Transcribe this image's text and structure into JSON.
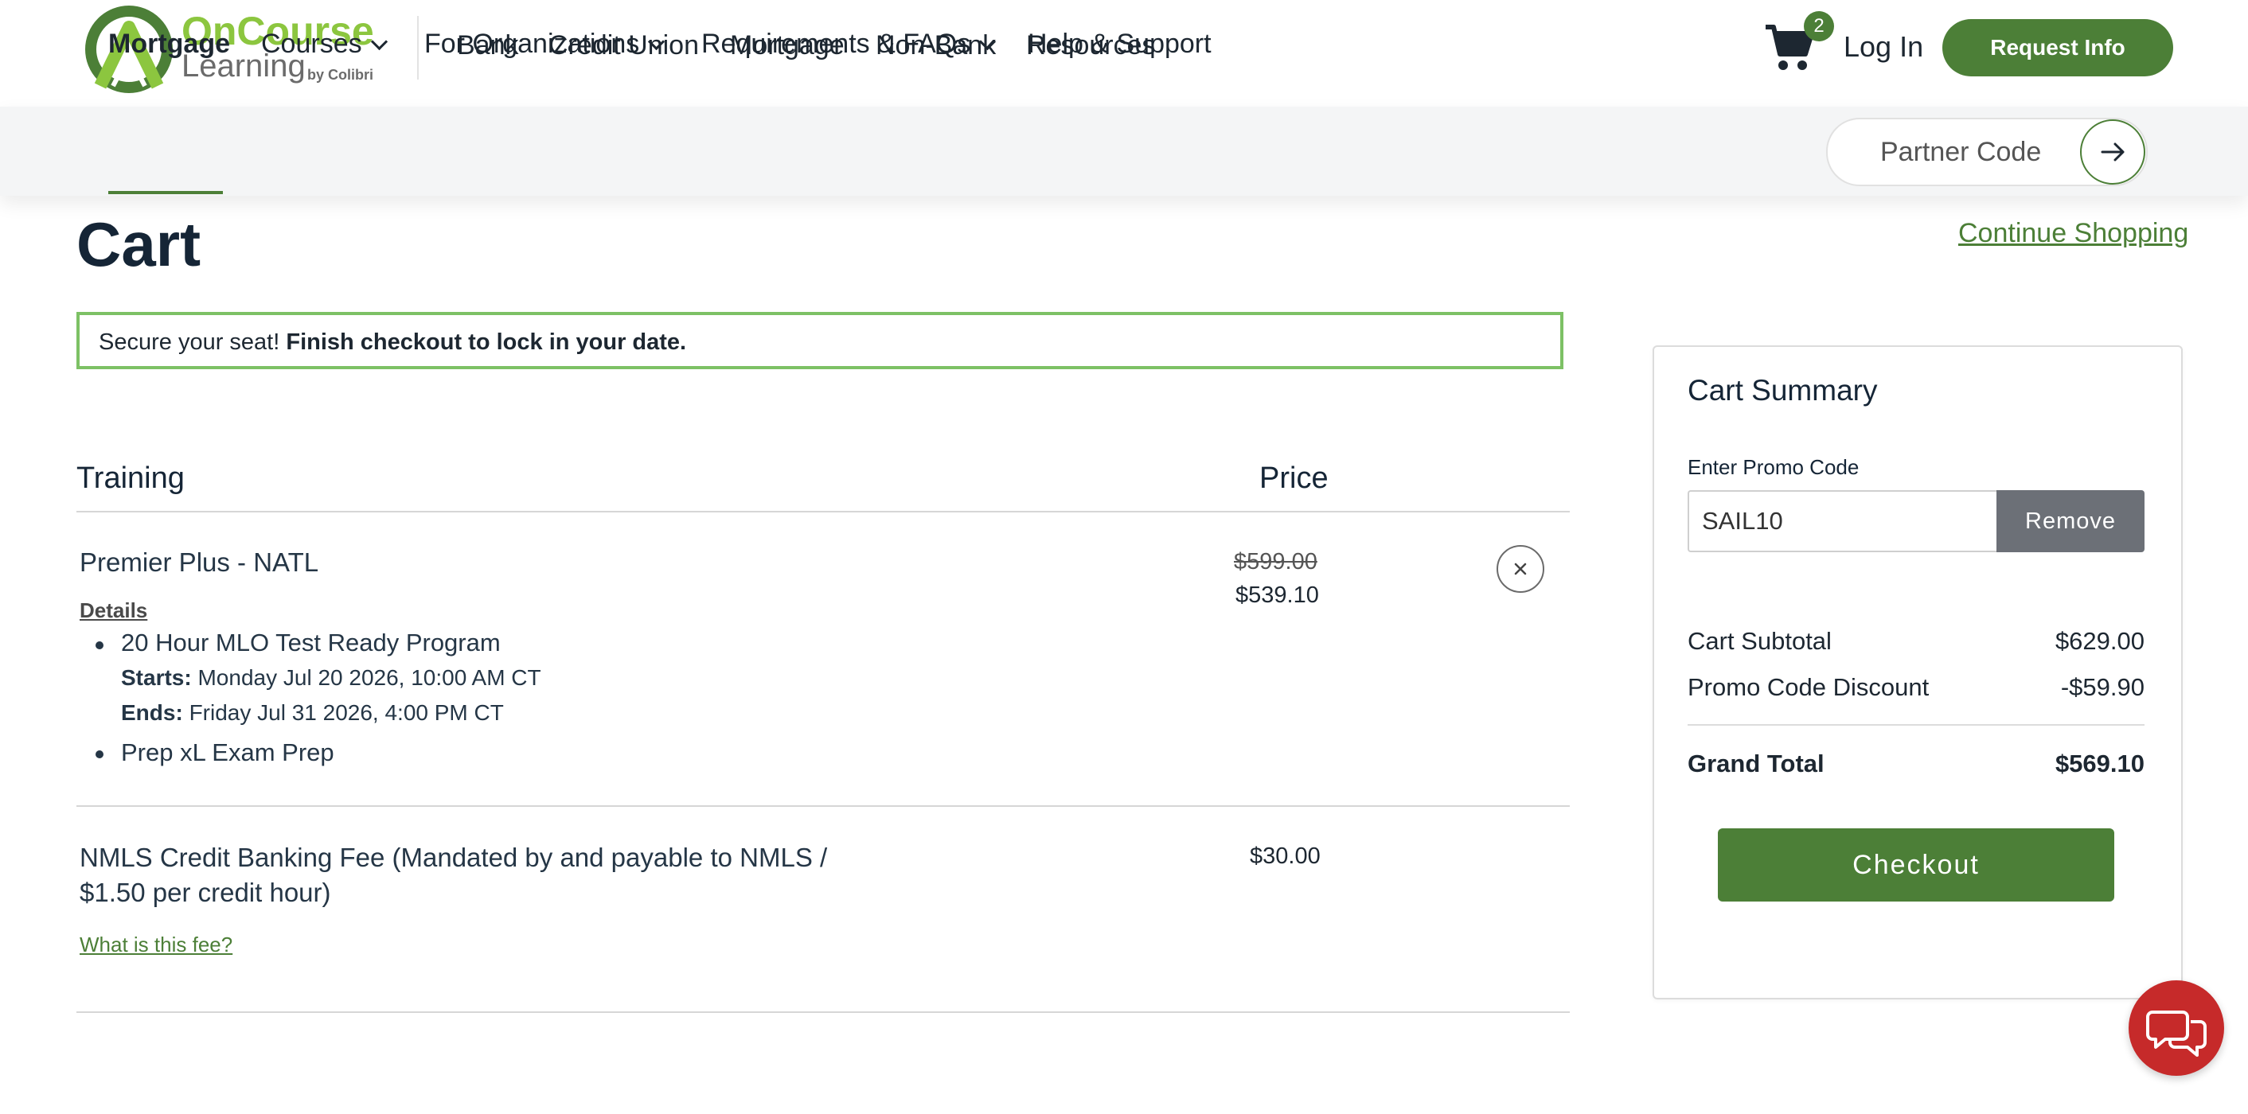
{
  "brand": {
    "name_line1": "OnCourse",
    "name_line2": "Learning",
    "byline": "by Colibri",
    "colors": {
      "primary": "#4c7f37",
      "accent_light": "#8cc63f",
      "text_dark": "#152536",
      "chat": "#c62a2a"
    }
  },
  "top_nav": {
    "items": [
      "Bank",
      "Credit Union",
      "Mortgage",
      "Non-Bank",
      "Resources"
    ],
    "cart": {
      "icon": "shopping-cart-icon",
      "count": "2"
    },
    "login_label": "Log In",
    "request_info_label": "Request Info"
  },
  "sub_nav": {
    "items": [
      {
        "label": "Mortgage",
        "active": true,
        "dropdown": false
      },
      {
        "label": "Courses",
        "active": false,
        "dropdown": true
      },
      {
        "label": "For Organizations",
        "active": false,
        "dropdown": true
      },
      {
        "label": "Requirements & FAQs",
        "active": false,
        "dropdown": true
      },
      {
        "label": "Help & Support",
        "active": false,
        "dropdown": false
      }
    ],
    "partner_code_placeholder": "Partner Code",
    "partner_go_icon": "arrow-right-icon"
  },
  "cart": {
    "title": "Cart",
    "continue_shopping": "Continue Shopping",
    "notice": {
      "text": "Secure your seat!",
      "bold": "Finish checkout to lock in your date."
    },
    "columns": {
      "training": "Training",
      "price": "Price"
    },
    "items": [
      {
        "name": "Premier Plus - NATL",
        "details_label": "Details",
        "details": [
          {
            "title": "20 Hour MLO Test Ready Program",
            "starts_label": "Starts:",
            "starts": "Monday Jul 20 2026, 10:00 AM CT",
            "ends_label": "Ends:",
            "ends": "Friday Jul 31 2026, 4:00 PM CT"
          },
          {
            "title": "Prep xL Exam Prep"
          }
        ],
        "original_price": "$599.00",
        "price": "$539.10",
        "remove_icon": "close-icon"
      },
      {
        "name": "NMLS Credit Banking Fee (Mandated by and payable to NMLS / $1.50 per credit hour)",
        "link": "What is this fee?",
        "price": "$30.00"
      }
    ]
  },
  "summary": {
    "title": "Cart Summary",
    "promo_label": "Enter Promo Code",
    "promo_value": "SAIL10",
    "promo_remove": "Remove",
    "rows": [
      {
        "label": "Cart Subtotal",
        "value": "$629.00"
      },
      {
        "label": "Promo Code Discount",
        "value": "-$59.90"
      }
    ],
    "grand_total_label": "Grand Total",
    "grand_total": "$569.10",
    "checkout_label": "Checkout"
  },
  "chat": {
    "icon": "chat-bubbles-icon"
  }
}
